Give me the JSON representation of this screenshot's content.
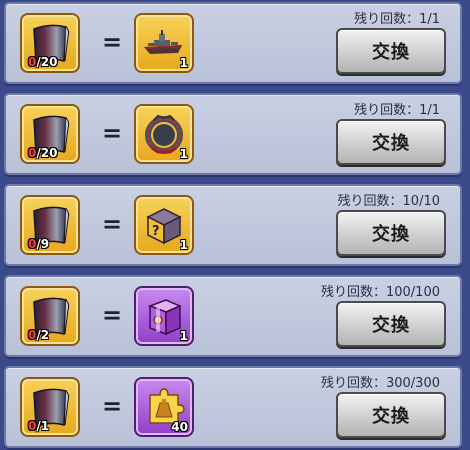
{
  "exchange_rows": [
    {
      "cost_have": "0",
      "cost_need": "/20",
      "reward_icon": "battleship-icon",
      "reward_qty": "1",
      "remaining": "残り回数：1/1",
      "button": "交換"
    },
    {
      "cost_have": "0",
      "cost_need": "/20",
      "reward_icon": "ring-frame-icon",
      "reward_qty": "1",
      "remaining": "残り回数：1/1",
      "button": "交換"
    },
    {
      "cost_have": "0",
      "cost_need": "/9",
      "reward_icon": "mystery-chest-icon",
      "reward_qty": "1",
      "remaining": "残り回数：10/10",
      "button": "交換"
    },
    {
      "cost_have": "0",
      "cost_need": "/2",
      "reward_icon": "purple-crate-icon",
      "reward_qty": "1",
      "remaining": "残り回数：100/100",
      "button": "交換"
    },
    {
      "cost_have": "0",
      "cost_need": "/1",
      "reward_icon": "puzzle-piece-icon",
      "reward_qty": "40",
      "remaining": "残り回数：300/300",
      "button": "交換"
    }
  ],
  "equals_symbol": "=",
  "colors": {
    "background": "#3b4a8a",
    "row": "#c3cadf",
    "slot_gold": "#eeb22a",
    "slot_purple": "#a754d9",
    "count_red": "#ff3b3b"
  }
}
